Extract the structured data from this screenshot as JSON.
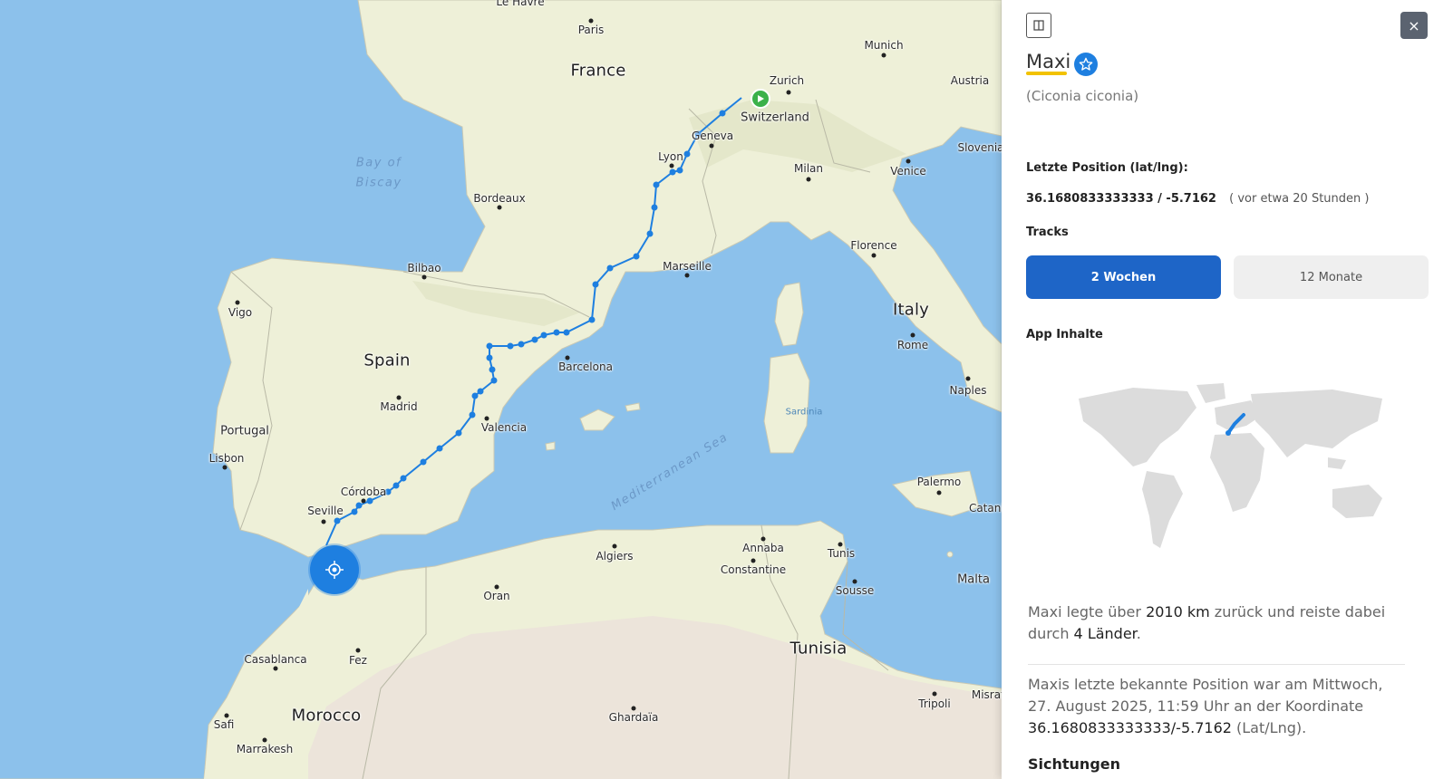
{
  "map": {
    "countries": [
      "France",
      "Switzerland",
      "Spain",
      "Portugal",
      "Italy",
      "Morocco",
      "Tunisia",
      "Malta"
    ],
    "cities": [
      "Paris",
      "Munich",
      "Zurich",
      "Austria",
      "Geneva",
      "Lyon",
      "Milan",
      "Venice",
      "Slovenia",
      "Bordeaux",
      "Bilbao",
      "Marseille",
      "Florence",
      "Vigo",
      "Barcelona",
      "Rome",
      "Madrid",
      "Naples",
      "Lisbon",
      "Valencia",
      "Córdoba",
      "Seville",
      "Palermo",
      "Catania",
      "Algiers",
      "Annaba",
      "Tunis",
      "Constantine",
      "Oran",
      "Sousse",
      "Casablanca",
      "Fez",
      "Safi",
      "Marrakesh",
      "Ghardaïa",
      "Tripoli",
      "Misrata",
      "Le Havre"
    ],
    "water": [
      "Bay of",
      "Biscay",
      "Mediterranean Sea"
    ],
    "islands": [
      "Sardinia"
    ],
    "track_color": "#1e7fe0",
    "start_marker_color": "#3bb14a",
    "icons": [
      "play-icon",
      "location-target-icon"
    ]
  },
  "panel": {
    "bird_name": "Maxi",
    "species": "(Ciconia ciconia)",
    "last_position_label": "Letzte Position (lat/lng):",
    "coordinates": "36.1680833333333 / -5.7162",
    "time_ago": "( vor etwa 20 Stunden )",
    "tracks_label": "Tracks",
    "tracks": {
      "two_weeks": "2 Wochen",
      "twelve_months": "12 Monate",
      "selected": "2 Wochen"
    },
    "app_content_label": "App Inhalte",
    "summary": {
      "prefix": "Maxi legte über ",
      "distance": "2010 km",
      "middle": " zurück und reiste dabei durch ",
      "countries": "4 Länder",
      "suffix": "."
    },
    "last_known": {
      "text": "Maxis letzte bekannte Position war am Mittwoch, 27. August 2025, 11:59 Uhr an der Koordinate ",
      "coords": "36.1680833333333/-5.7162",
      "suffix": " (Lat/Lng)."
    },
    "sightings_label": "Sichtungen",
    "close_symbol": "×",
    "accent_color": "#1e65c7",
    "highlight_color": "#f2c200"
  }
}
